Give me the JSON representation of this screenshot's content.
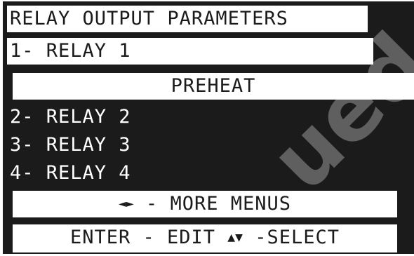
{
  "screen": {
    "title": "RELAY OUTPUT PARAMETERS",
    "selected_item": "1- RELAY 1",
    "selected_value": "PREHEAT",
    "items": [
      {
        "label": "2- RELAY 2"
      },
      {
        "label": "3- RELAY 3"
      },
      {
        "label": "4- RELAY 4"
      }
    ],
    "more_menus": {
      "arrows": "◄►",
      "label": " - MORE MENUS"
    },
    "footer": {
      "enter_label": "ENTER - EDIT ",
      "arrows": "▲▼",
      "select_label": " -SELECT"
    }
  },
  "watermark": "ued",
  "colors": {
    "background": "#1b1b1b",
    "foreground": "#ffffff"
  }
}
